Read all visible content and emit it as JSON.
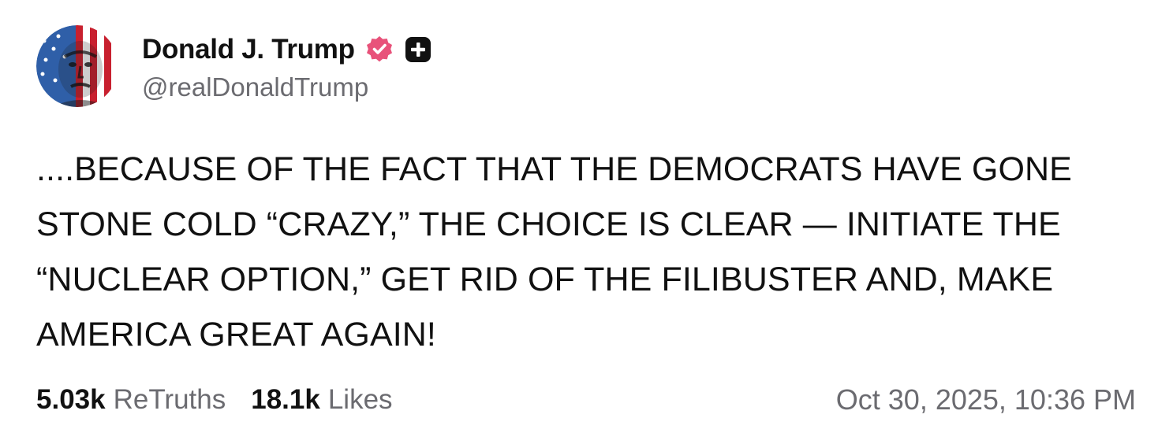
{
  "author": {
    "display_name": "Donald J. Trump",
    "handle": "@realDonaldTrump",
    "avatar_icon": "flag-portrait-avatar",
    "verified_icon": "verified-badge-icon",
    "verified_color": "#e8527a",
    "plus_icon": "plus-badge-icon",
    "plus_color": "#111111"
  },
  "post": {
    "lines": [
      "....BECAUSE OF THE FACT THAT THE DEMOCRATS HAVE GONE",
      "STONE COLD “CRAZY,” THE CHOICE IS CLEAR — INITIATE THE",
      "“NUCLEAR OPTION,” GET RID OF THE FILIBUSTER AND, MAKE",
      "AMERICA GREAT AGAIN!"
    ]
  },
  "stats": {
    "retruths_count": "5.03k",
    "retruths_label": "ReTruths",
    "likes_count": "18.1k",
    "likes_label": "Likes"
  },
  "timestamp": "Oct 30, 2025, 10:36 PM",
  "colors": {
    "text": "#111111",
    "muted": "#6b6b70",
    "background": "#ffffff"
  }
}
